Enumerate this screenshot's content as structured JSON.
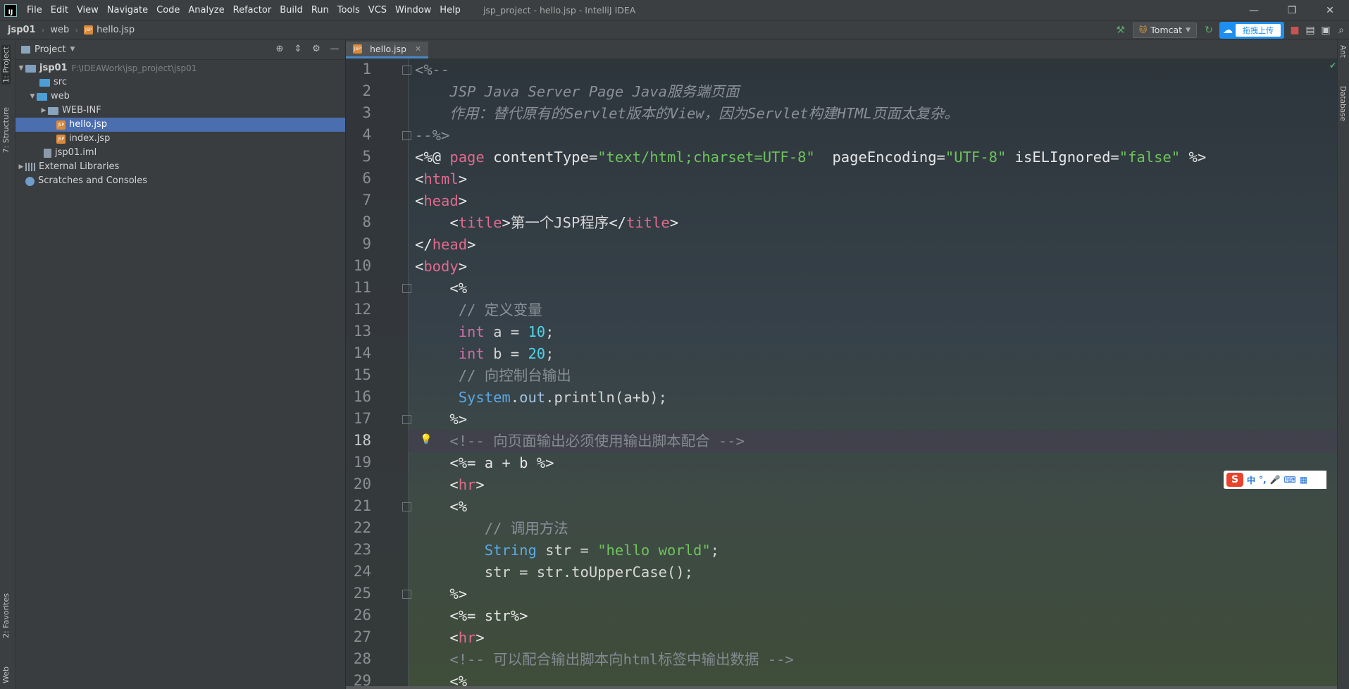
{
  "window": {
    "logo_text": "IJ",
    "title": "jsp_project - hello.jsp - IntelliJ IDEA",
    "minimize": "—",
    "maximize": "❐",
    "close": "✕"
  },
  "menu": [
    "File",
    "Edit",
    "View",
    "Navigate",
    "Code",
    "Analyze",
    "Refactor",
    "Build",
    "Run",
    "Tools",
    "VCS",
    "Window",
    "Help"
  ],
  "breadcrumb": [
    "jsp01",
    "web",
    "hello.jsp"
  ],
  "toolbar": {
    "run_config": "Tomcat",
    "upload_button": "拖拽上传"
  },
  "left_strip": {
    "project_tab": "1: Project",
    "structure_tab": "7: Structure",
    "favorites_tab": "2: Favorites",
    "web_tab": "Web"
  },
  "right_strip": {
    "ant_tab": "Ant",
    "database_tab": "Database"
  },
  "project_panel": {
    "title": "Project",
    "tree": [
      {
        "label": "jsp01",
        "hint": "F:\\IDEAWork\\jsp_project\\jsp01",
        "type": "module",
        "expanded": true
      },
      {
        "label": "src",
        "type": "folder"
      },
      {
        "label": "web",
        "type": "folder",
        "expanded": true
      },
      {
        "label": "WEB-INF",
        "type": "folder",
        "expanded": false
      },
      {
        "label": "hello.jsp",
        "type": "jsp",
        "selected": true
      },
      {
        "label": "index.jsp",
        "type": "jsp"
      },
      {
        "label": "jsp01.iml",
        "type": "iml"
      },
      {
        "label": "External Libraries",
        "type": "lib",
        "expanded": false
      },
      {
        "label": "Scratches and Consoles",
        "type": "scratch"
      }
    ]
  },
  "editor": {
    "tab_label": "hello.jsp",
    "line_numbers": [
      "1",
      "2",
      "3",
      "4",
      "5",
      "6",
      "7",
      "8",
      "9",
      "10",
      "11",
      "12",
      "13",
      "14",
      "15",
      "16",
      "17",
      "18",
      "19",
      "20",
      "21",
      "22",
      "23",
      "24",
      "25",
      "26",
      "27",
      "28",
      "29"
    ],
    "current_line": "18"
  },
  "ime": {
    "logo": "S",
    "items": [
      "中",
      "°,",
      "🎤",
      "⌨",
      "▦"
    ]
  },
  "colors": {
    "selection": "#4b6eaf",
    "tab_underline": "#4a88c7",
    "tag": "#e06a8c",
    "string": "#6fc35c",
    "number": "#4fd3e6",
    "keyword": "#cc6fa8",
    "class": "#5aa9e6"
  },
  "icons": {
    "build": "hammer-icon",
    "run_config": "tomcat-icon",
    "rerun": "rerun-icon",
    "cloud": "baidu-cloud-icon",
    "search": "search-icon",
    "structure": "project-structure-icon",
    "locate": "locate-icon",
    "collapse": "collapse-all-icon",
    "settings": "gear-icon",
    "hide": "minimize-panel-icon"
  }
}
